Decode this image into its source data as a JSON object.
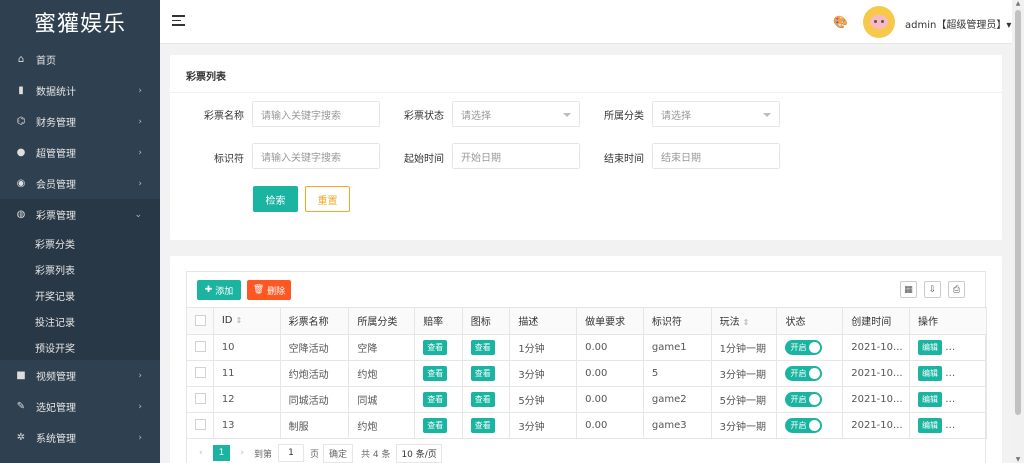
{
  "app": {
    "logo": "蜜獾娱乐"
  },
  "sidebar": {
    "items": [
      {
        "label": "首页",
        "icon": "home-icon",
        "glyph": "⌂"
      },
      {
        "label": "数据统计",
        "icon": "bar-chart-icon",
        "glyph": "▮"
      },
      {
        "label": "财务管理",
        "icon": "bank-icon",
        "glyph": "⌬"
      },
      {
        "label": "超管管理",
        "icon": "user-icon",
        "glyph": "●"
      },
      {
        "label": "会员管理",
        "icon": "users-icon",
        "glyph": "◉"
      },
      {
        "label": "彩票管理",
        "icon": "gamepad-icon",
        "glyph": "◍"
      }
    ],
    "sub_items": [
      "彩票分类",
      "彩票列表",
      "开奖记录",
      "投注记录",
      "预设开奖"
    ],
    "items_after": [
      {
        "label": "视频管理",
        "icon": "video-icon",
        "glyph": "■"
      },
      {
        "label": "选妃管理",
        "icon": "edit-icon",
        "glyph": "✎"
      },
      {
        "label": "系统管理",
        "icon": "gear-icon",
        "glyph": "✲"
      }
    ]
  },
  "header": {
    "user": "admin【超级管理员】▾"
  },
  "search_panel": {
    "title": "彩票列表",
    "fields": [
      {
        "label": "彩票名称",
        "placeholder": "请输入关键字搜索"
      },
      {
        "label": "彩票状态",
        "placeholder": "请选择"
      },
      {
        "label": "所属分类",
        "placeholder": "请选择"
      },
      {
        "label": "标识符",
        "placeholder": "请输入关键字搜索"
      },
      {
        "label": "起始时间",
        "placeholder": "开始日期"
      },
      {
        "label": "结束时间",
        "placeholder": "结束日期"
      }
    ],
    "search_label": "检索",
    "reset_label": "重置"
  },
  "toolbar": {
    "add_label": "添加",
    "delete_label": "删除"
  },
  "table": {
    "headers": [
      "ID",
      "彩票名称",
      "所属分类",
      "赔率",
      "图标",
      "描述",
      "做单要求",
      "标识符",
      "玩法",
      "状态",
      "创建时间",
      "操作"
    ],
    "rows": [
      {
        "id": "10",
        "name": "空降活动",
        "category": "空降",
        "odds": "查看",
        "icon": "查看",
        "desc": "1分钟",
        "req": "0.00",
        "code": "game1",
        "play": "1分钟一期",
        "status": "开启",
        "created": "2021-10...",
        "edit": "编辑"
      },
      {
        "id": "11",
        "name": "约炮活动",
        "category": "约炮",
        "odds": "查看",
        "icon": "查看",
        "desc": "3分钟",
        "req": "0.00",
        "code": "5",
        "play": "3分钟一期",
        "status": "开启",
        "created": "2021-10...",
        "edit": "编辑"
      },
      {
        "id": "12",
        "name": "同城活动",
        "category": "同城",
        "odds": "查看",
        "icon": "查看",
        "desc": "5分钟",
        "req": "0.00",
        "code": "game2",
        "play": "5分钟一期",
        "status": "开启",
        "created": "2021-10...",
        "edit": "编辑"
      },
      {
        "id": "13",
        "name": "制服",
        "category": "约炮",
        "odds": "查看",
        "icon": "查看",
        "desc": "3分钟",
        "req": "0.00",
        "code": "game3",
        "play": "3分钟一期",
        "status": "开启",
        "created": "2021-10...",
        "edit": "编辑"
      }
    ]
  },
  "pagination": {
    "current": "1",
    "goto_label": "到第",
    "goto_value": "1",
    "page_unit": "页",
    "confirm_label": "确定",
    "total": "共 4 条",
    "per_page": "10 条/页"
  }
}
